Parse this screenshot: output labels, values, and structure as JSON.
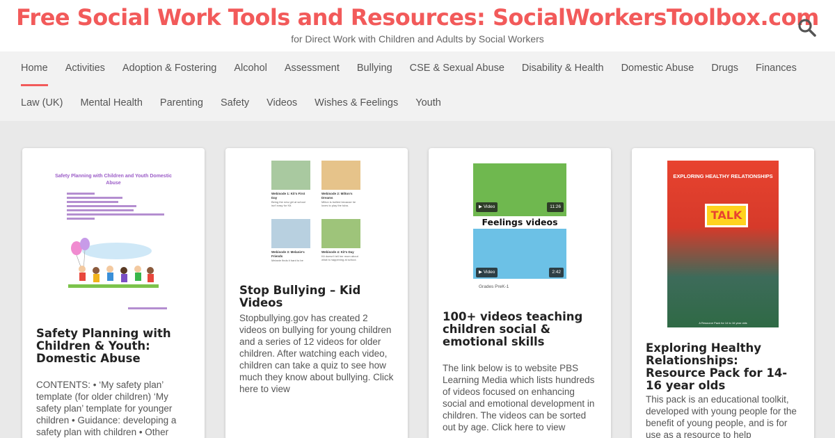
{
  "header": {
    "title": "Free Social Work Tools and Resources: SocialWorkersToolbox.com",
    "tagline": "for Direct Work with Children and Adults by Social Workers"
  },
  "nav": {
    "row1": [
      "Home",
      "Activities",
      "Adoption & Fostering",
      "Alcohol",
      "Assessment",
      "Bullying",
      "CSE & Sexual Abuse",
      "Disability & Health",
      "Domestic Abuse",
      "Drugs",
      "Finances"
    ],
    "row2": [
      "Law (UK)",
      "Mental Health",
      "Parenting",
      "Safety",
      "Videos",
      "Wishes & Feelings",
      "Youth"
    ],
    "active": "Home"
  },
  "cards": [
    {
      "title": "Safety Planning with Children & Youth: Domestic Abuse",
      "text": "CONTENTS: • ‘My safety plan’ template (for older children) ‘My safety plan’ template for younger children • Guidance: developing a safety plan with children • Other",
      "thumb_title": "Safety Planning with Children and Youth Domestic Abuse"
    },
    {
      "title": "Stop Bullying – Kid Videos",
      "text": "Stopbullying.gov has created 2 videos on bullying for young children and a series of 12 videos for older children. After watching each video, children can take a quiz to see how much they know about bullying. Click here to view",
      "thumb_items": [
        {
          "cap": "Webisode 1: Kit's First Day",
          "sub": "Being the new girl at school isn't easy for Kit."
        },
        {
          "cap": "Webisode 2: Milton's Dreams",
          "sub": "Milton is bullied because he loves to play the tuba."
        },
        {
          "cap": "Webisode 3: Melanie's Friends",
          "sub": "Melanie finds it hard to be"
        },
        {
          "cap": "Webisode 4: Kit's Day",
          "sub": "Kit doesn't tell her mom about what is happening at school."
        }
      ]
    },
    {
      "title": "100+ videos teaching children social & emotional skills",
      "text": "The link below is to website PBS Learning Media which lists hundreds of videos focused on enhancing social and emotional development in children. The videos can be sorted out by age. Click here to view",
      "thumb_band": "Feelings videos",
      "badge_video": "Video",
      "duration1": "11:26",
      "duration2": "2:42",
      "grade": "Grades PreK-1"
    },
    {
      "title": "Exploring Healthy Relationships: Resource Pack for 14-16 year olds",
      "text": "This pack is an educational toolkit, developed with young people for the benefit of young people, and is for use as a resource to help",
      "cover_title": "EXPLORING HEALTHY RELATIONSHIPS",
      "cover_word": "TALK",
      "cover_foot": "A Resource Pack for 14 to 16 year olds"
    }
  ],
  "colors": {
    "accent": "#f25a5a",
    "nav_bg": "#f2f2f2",
    "page_bg": "#e9e9e9"
  }
}
